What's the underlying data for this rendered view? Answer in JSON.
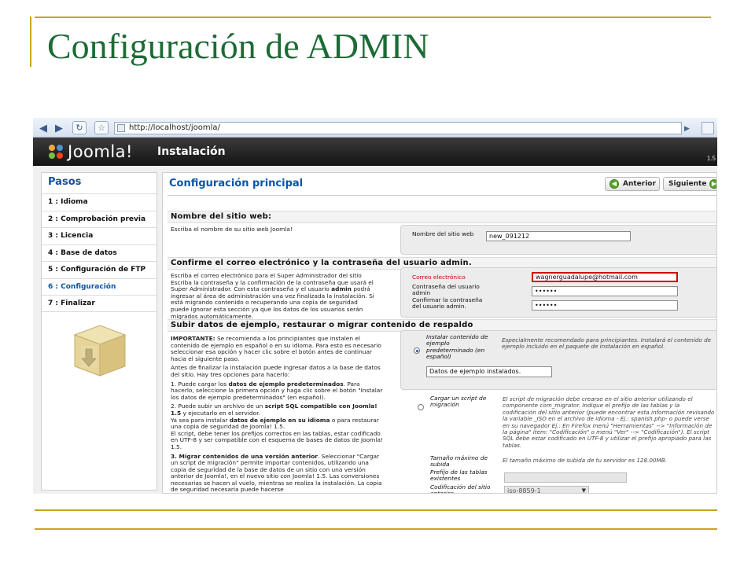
{
  "slide": {
    "title": "Configuración de ADMIN"
  },
  "browser": {
    "url": "http://localhost/joomla/"
  },
  "header": {
    "brand": "Joomla!",
    "section": "Instalación",
    "version": "1.5"
  },
  "sidebar": {
    "title": "Pasos",
    "steps": [
      "1 : Idioma",
      "2 : Comprobación previa",
      "3 : Licencia",
      "4 : Base de datos",
      "5 : Configuración de FTP",
      "6 : Configuración",
      "7 : Finalizar"
    ],
    "active_index": 5
  },
  "main": {
    "title": "Configuración principal",
    "btn_prev": "Anterior",
    "btn_next": "Siguiente",
    "site": {
      "heading": "Nombre del sitio web:",
      "help": "Escriba el nombre de su sitio web Joomla!",
      "label": "Nombre del sitio web",
      "value": "new_091212"
    },
    "admin": {
      "heading": "Confirme el correo electrónico y la contraseña del usuario admin.",
      "help_a": "Escriba el correo electrónico para el Super Administrador del sitio Escriba la contraseña y la confirmación de la contraseña que usará el Super Administrador. Con esta contraseña y el usuario",
      "help_bold": "admin",
      "help_b": "podrá ingresar al área de administración una vez finalizada la instalación. Si está migrando contenido o recuperando una copia de seguridad puede ignorar esta sección ya que los datos de los usuarios serán migrados automáticamente.",
      "email_label": "Correo electrónico",
      "email_value": "wagnerguadalupe@hotmail.com",
      "pass_label": "Contraseña del usuario admin",
      "pass_value": "••••••",
      "confirm_label": "Confirmar la contraseña del usuario admin.",
      "confirm_value": "••••••"
    },
    "sample": {
      "heading": "Subir datos de ejemplo, restaurar o migrar contenido de respaldo",
      "p1_bold": "IMPORTANTE:",
      "p1": "Se recomienda a los principiantes que instalen el contenido de ejemplo en español o en su idioma. Para esto es necesario seleccionar esa opción y hacer clic sobre el botón antes de continuar hacia el siguiente paso.",
      "p2": "Antes de finalizar la instalación puede ingresar datos a la base de datos del sitio. Hay tres opciones para hacerlo:",
      "p3_a": "1. Puede cargar los",
      "p3_bold": "datos de ejemplo predeterminados",
      "p3_b": ". Para hacerlo, seleccione la primera opción y haga clic sobre el botón \"Instalar los datos de ejemplo predeterminados\" (en español).",
      "p4_a": "2. Puede subir un archivo de un",
      "p4_bold": "script SQL compatible con Joomla! 1.5",
      "p4_b": "y ejecutarlo en el servidor.",
      "p4_c": "Ya sea para instalar",
      "p4_bold2": "datos de ejemplo en su idioma",
      "p4_d": "o para restaurar una copia de seguridad de Joomla! 1.5.",
      "p4_e": "El script, debe tener los prefijos correctos en las tablas, estar codificado en UTF-8 y ser compatible con el esquema de bases de datos de Joomla! 1.5.",
      "p5_bold": "3. Migrar contenidos de una versión anterior",
      "p5": ". Seleccionar \"Cargar un script de migración\" permite importar contenidos, utilizando una copia de seguridad de la base de datos de un sitio con una versión anterior de Joomla!, en el nuevo sitio con Joomla! 1.5. Las conversiones necesarias se hacen al vuelo, mientras se realiza la instalación. La copia de seguridad necesaria puede hacerse",
      "opt1_label": "Instalar contenido de ejemplo predeterminado (en español)",
      "opt1_note": "Especialmente recomendado para principiantes. Instalará el contenido de ejemplo incluido en el paquete de instalación en español.",
      "opt1_button": "Datos de ejemplo instalados.",
      "opt2_label": "Cargar un script de migración",
      "opt2_note": "El script de migración debe crearse en el sitio anterior utilizando el componente com_migrator. Indique el prefijo de las tablas y la codificación del sitio anterior (puede encontrar esta información revisando la variable _ISO en el archivo de idioma - Ej.: spanish.php- o puede verse en su navegador Ej.: En Firefox menú \"Herramientas\" --> \"Información de la página\" item: \"Codificación\" o menú \"Ver\" --> \"Codificación\"). El script SQL debe estar codificado en UTF-8 y utilizar el prefijo apropiado para las tablas.",
      "max_label": "Tamaño máximo de subida",
      "max_value": "El tamaño máximo de subida de tu servidor es 128.00MB.",
      "prefix_label": "Prefijo de las tablas existentes",
      "prefix_value": "",
      "enc_label": "Codificación del sitio anterior",
      "enc_value": "iso-8859-1"
    }
  }
}
